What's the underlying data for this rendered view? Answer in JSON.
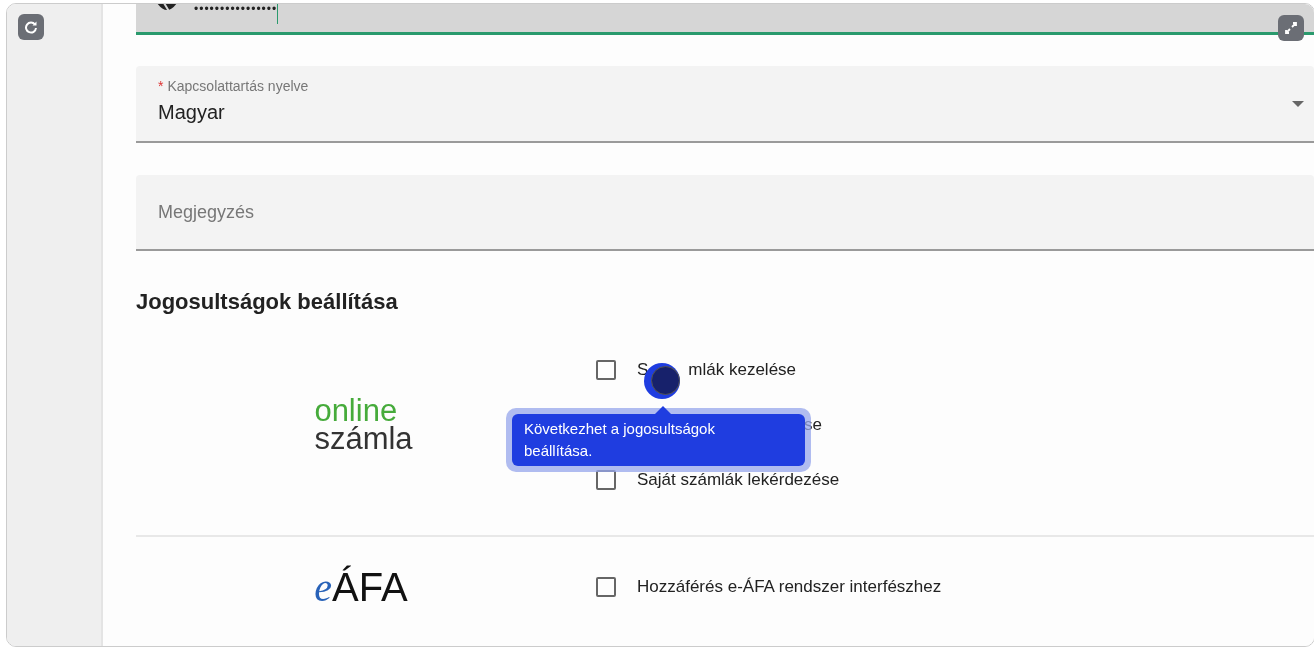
{
  "password_field": {
    "value": "••••••••••••••••"
  },
  "language_field": {
    "required_mark": "*",
    "label": "Kapcsolattartás nyelve",
    "value": "Magyar"
  },
  "note_field": {
    "placeholder": "Megjegyzés"
  },
  "permissions": {
    "title": "Jogosultságok beállítása",
    "sections": [
      {
        "kind": "online_szamla",
        "logo_top": "online",
        "logo_bottom": "számla",
        "options": [
          {
            "label_start": "S",
            "label": "mlák kezelése",
            "checked": false,
            "kind": "split"
          },
          {
            "label": "se",
            "kind": "covered"
          },
          {
            "label": "Saját számlák lekérdezése",
            "checked": false,
            "kind": "plain"
          }
        ]
      },
      {
        "kind": "eafa",
        "logo_top": "e",
        "logo_bottom": "ÁFA",
        "options": [
          {
            "label": "Hozzáférés e-ÁFA rendszer interfészhez",
            "checked": false,
            "kind": "plain"
          }
        ]
      }
    ]
  },
  "tooltip": {
    "text": "Következhet a jogosultságok beállítása."
  }
}
